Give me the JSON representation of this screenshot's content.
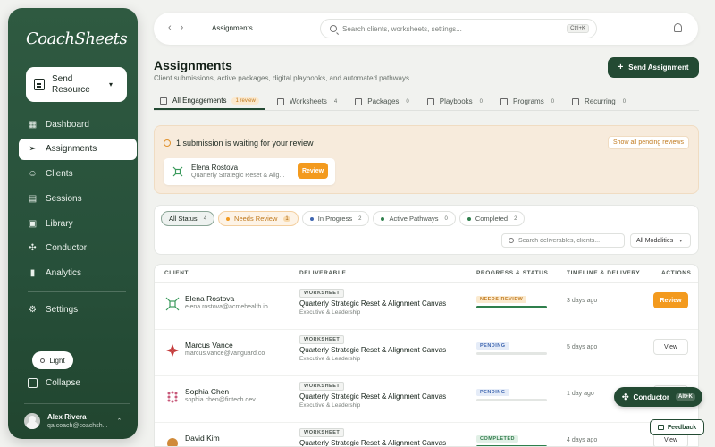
{
  "app": {
    "logo": "CoachSheets"
  },
  "sidebar": {
    "send_resource": "Send Resource",
    "items": [
      {
        "label": "Dashboard",
        "icon": "grid-icon"
      },
      {
        "label": "Assignments",
        "icon": "send-icon",
        "active": true
      },
      {
        "label": "Clients",
        "icon": "users-icon"
      },
      {
        "label": "Sessions",
        "icon": "calendar-icon"
      },
      {
        "label": "Library",
        "icon": "library-icon"
      },
      {
        "label": "Conductor",
        "icon": "conductor-icon"
      },
      {
        "label": "Analytics",
        "icon": "chart-icon"
      }
    ],
    "settings": "Settings",
    "theme": "Light",
    "collapse": "Collapse",
    "user": {
      "name": "Alex Rivera",
      "email": "qa.coach@coachsh..."
    }
  },
  "topbar": {
    "breadcrumb": "Assignments",
    "search_placeholder": "Search clients, worksheets, settings...",
    "shortcut": "Ctrl+K"
  },
  "header": {
    "title": "Assignments",
    "subtitle": "Client submissions, active packages, digital playbooks, and automated pathways.",
    "send_assignment": "Send Assignment"
  },
  "tabs": [
    {
      "label": "All Engagements",
      "badge": "1 review",
      "active": true
    },
    {
      "label": "Worksheets",
      "count": "4"
    },
    {
      "label": "Packages",
      "count": "0"
    },
    {
      "label": "Playbooks",
      "count": "0"
    },
    {
      "label": "Programs",
      "count": "0"
    },
    {
      "label": "Recurring",
      "count": "0"
    }
  ],
  "review_banner": {
    "title": "1 submission is waiting for your review",
    "show_all": "Show all pending reviews",
    "card": {
      "name": "Elena Rostova",
      "deliverable": "Quarterly Strategic Reset & Alig...",
      "action": "Review"
    }
  },
  "filters": {
    "chips": [
      {
        "label": "All Status",
        "count": "4",
        "state": "active"
      },
      {
        "label": "Needs Review",
        "count": "1",
        "state": "warn",
        "dot": "#f39a1e"
      },
      {
        "label": "In Progress",
        "count": "2",
        "dot": "#3f66b0"
      },
      {
        "label": "Active Pathways",
        "count": "0",
        "dot": "#2f7f4c"
      },
      {
        "label": "Completed",
        "count": "2",
        "dot": "#2f7f4c"
      }
    ],
    "search_placeholder": "Search deliverables, clients...",
    "modality": "All Modalities"
  },
  "table": {
    "columns": [
      "CLIENT",
      "DELIVERABLE",
      "PROGRESS & STATUS",
      "TIMELINE & DELIVERY",
      "ACTIONS"
    ],
    "rows": [
      {
        "name": "Elena Rostova",
        "email": "elena.rostova@acmehealth.io",
        "tag": "WORKSHEET",
        "deliverable": "Quarterly Strategic Reset & Alignment Canvas",
        "category": "Executive & Leadership",
        "status": "NEEDS REVIEW",
        "status_kind": "review",
        "progress": 100,
        "time": "3 days ago",
        "action": "Review",
        "action_kind": "primary",
        "logo_color": "#3a9a5c"
      },
      {
        "name": "Marcus Vance",
        "email": "marcus.vance@vanguard.co",
        "tag": "WORKSHEET",
        "deliverable": "Quarterly Strategic Reset & Alignment Canvas",
        "category": "Executive & Leadership",
        "status": "PENDING",
        "status_kind": "pending",
        "progress": 0,
        "time": "5 days ago",
        "action": "View",
        "action_kind": "ghost",
        "logo_color": "#c43b3b"
      },
      {
        "name": "Sophia Chen",
        "email": "sophia.chen@fintech.dev",
        "tag": "WORKSHEET",
        "deliverable": "Quarterly Strategic Reset & Alignment Canvas",
        "category": "Executive & Leadership",
        "status": "PENDING",
        "status_kind": "pending",
        "progress": 0,
        "time": "1 day ago",
        "action": "View",
        "action_kind": "ghost",
        "logo_color": "#c85a7a"
      },
      {
        "name": "David Kim",
        "email": "",
        "tag": "WORKSHEET",
        "deliverable": "Quarterly Strategic Reset & Alignment Canvas",
        "category": "",
        "status": "COMPLETED",
        "status_kind": "completed",
        "progress": 100,
        "time": "4 days ago",
        "action": "View",
        "action_kind": "ghost",
        "logo_color": "#d08a3a"
      }
    ]
  },
  "floating": {
    "conductor": "Conductor",
    "conductor_shortcut": "Alt+K",
    "feedback": "Feedback"
  }
}
